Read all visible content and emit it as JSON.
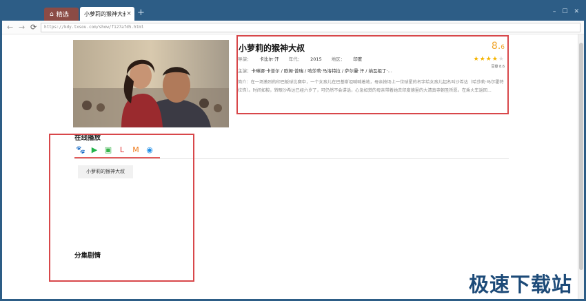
{
  "tabs": {
    "home_label": "精选",
    "active_label": "小萝莉的猴神大叔",
    "close_glyph": "×",
    "new_tab_glyph": "+"
  },
  "window_controls": {
    "minimize": "–",
    "maximize": "☐",
    "close": "✕"
  },
  "navbar": {
    "back_glyph": "←",
    "forward_glyph": "→",
    "reload_glyph": "⟳",
    "url": "https://kdy.txsou.com/show/f127afd5.html"
  },
  "movie": {
    "title": "小萝莉的猴神大叔",
    "rating_main": "8.",
    "rating_decimal": "6",
    "stars_full": "★★★★",
    "stars_empty": "★",
    "rating_count_label": "豆瓣 8.6",
    "director_label": "导演：",
    "director": "卡比尔·汗",
    "year_label": "年代：",
    "year": "2015",
    "region_label": "地区：",
    "region": "印度",
    "cast_label": "主演：",
    "cast": "卡琳娜·卡普尔 / 欧姆·普瑞 / 哈莎莉·马洛特拉 / 萨尔曼·汗 / 纳瓦祖丁·...",
    "synopsis_label": "简介：",
    "synopsis": "在一场激烈的印巴板球比赛中，一个女孩儿在巴基斯坦喊喊着地，母亲按场上一位球星的名字给女孩儿起名叫沙希达（哈莎莉·马尔霍特拉饰）。时间如梭，转眼沙希达已经六岁了，可仍然不会讲话，心急如焚的母亲带着她去印度德里的大清真寺朝圣祈愿。在乘火车返回..."
  },
  "online_play": {
    "title": "在线播放",
    "sources": [
      {
        "icon": "baidu-icon",
        "glyph": "🐾",
        "color": "#3a6fd8"
      },
      {
        "icon": "play-icon",
        "glyph": "▶",
        "color": "#21b34a"
      },
      {
        "icon": "iqiyi-icon",
        "glyph": "▣",
        "color": "#36b34a"
      },
      {
        "icon": "letv-icon",
        "glyph": "L",
        "color": "#e02c2c"
      },
      {
        "icon": "mango-icon",
        "glyph": "M",
        "color": "#ef7b1c"
      },
      {
        "icon": "tencent-icon",
        "glyph": "◉",
        "color": "#1e8ee8"
      }
    ],
    "episode_button": "小萝莉的猴神大叔"
  },
  "episodes_section": {
    "title": "分集剧情"
  },
  "watermark": "极速下载站",
  "colors": {
    "accent": "#d8474a",
    "rating": "#f0a52c",
    "chrome": "#2d5d86"
  }
}
